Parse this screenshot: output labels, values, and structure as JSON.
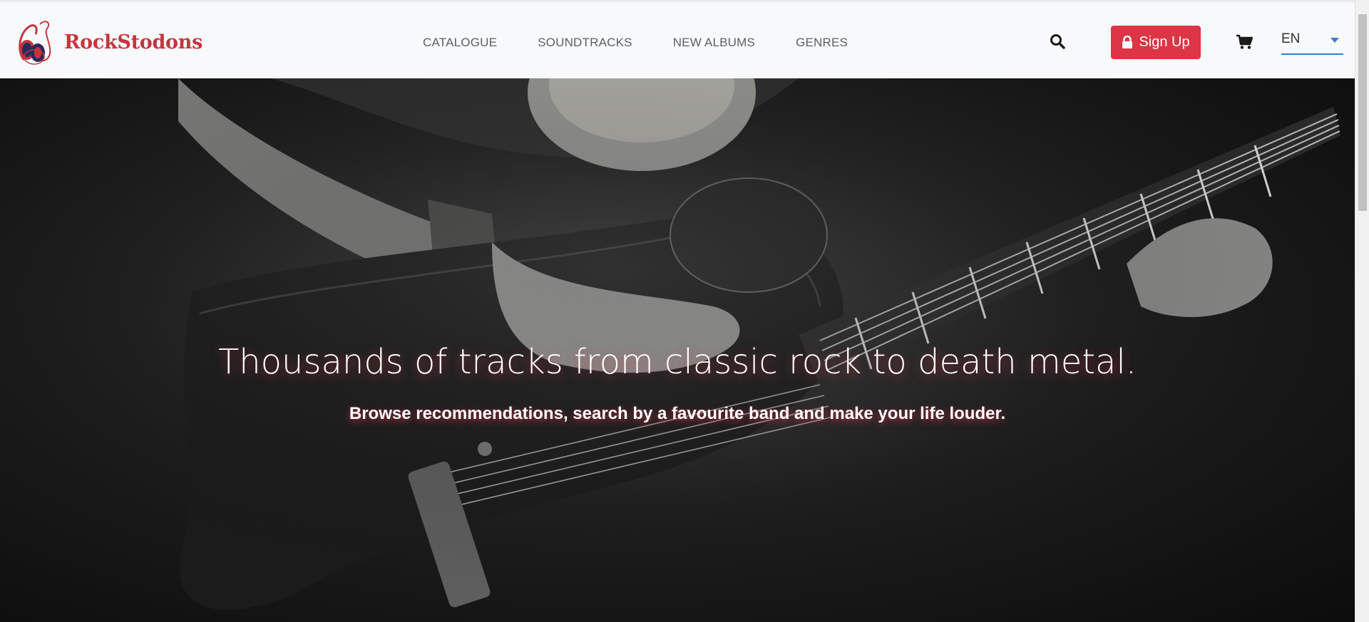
{
  "brand": {
    "name": "RockStodons",
    "color": "#c4353f",
    "logo_icon": "headphones-music-note-icon"
  },
  "nav": {
    "items": [
      "CATALOGUE",
      "SOUNDTRACKS",
      "NEW ALBUMS",
      "GENRES"
    ]
  },
  "header": {
    "search_icon": "search-icon",
    "signup_label": "Sign Up",
    "signup_icon": "lock-icon",
    "signup_color": "#dc3545",
    "cart_icon": "cart-icon",
    "language": {
      "value": "EN",
      "accent": "#3d7bd9"
    }
  },
  "hero": {
    "title": "Thousands of tracks from classic rock to death metal.",
    "subtitle": "Browse recommendations, search by a favourite band and make your life louder.",
    "background": "black-and-white photo of a guitarist playing an electric guitar"
  }
}
